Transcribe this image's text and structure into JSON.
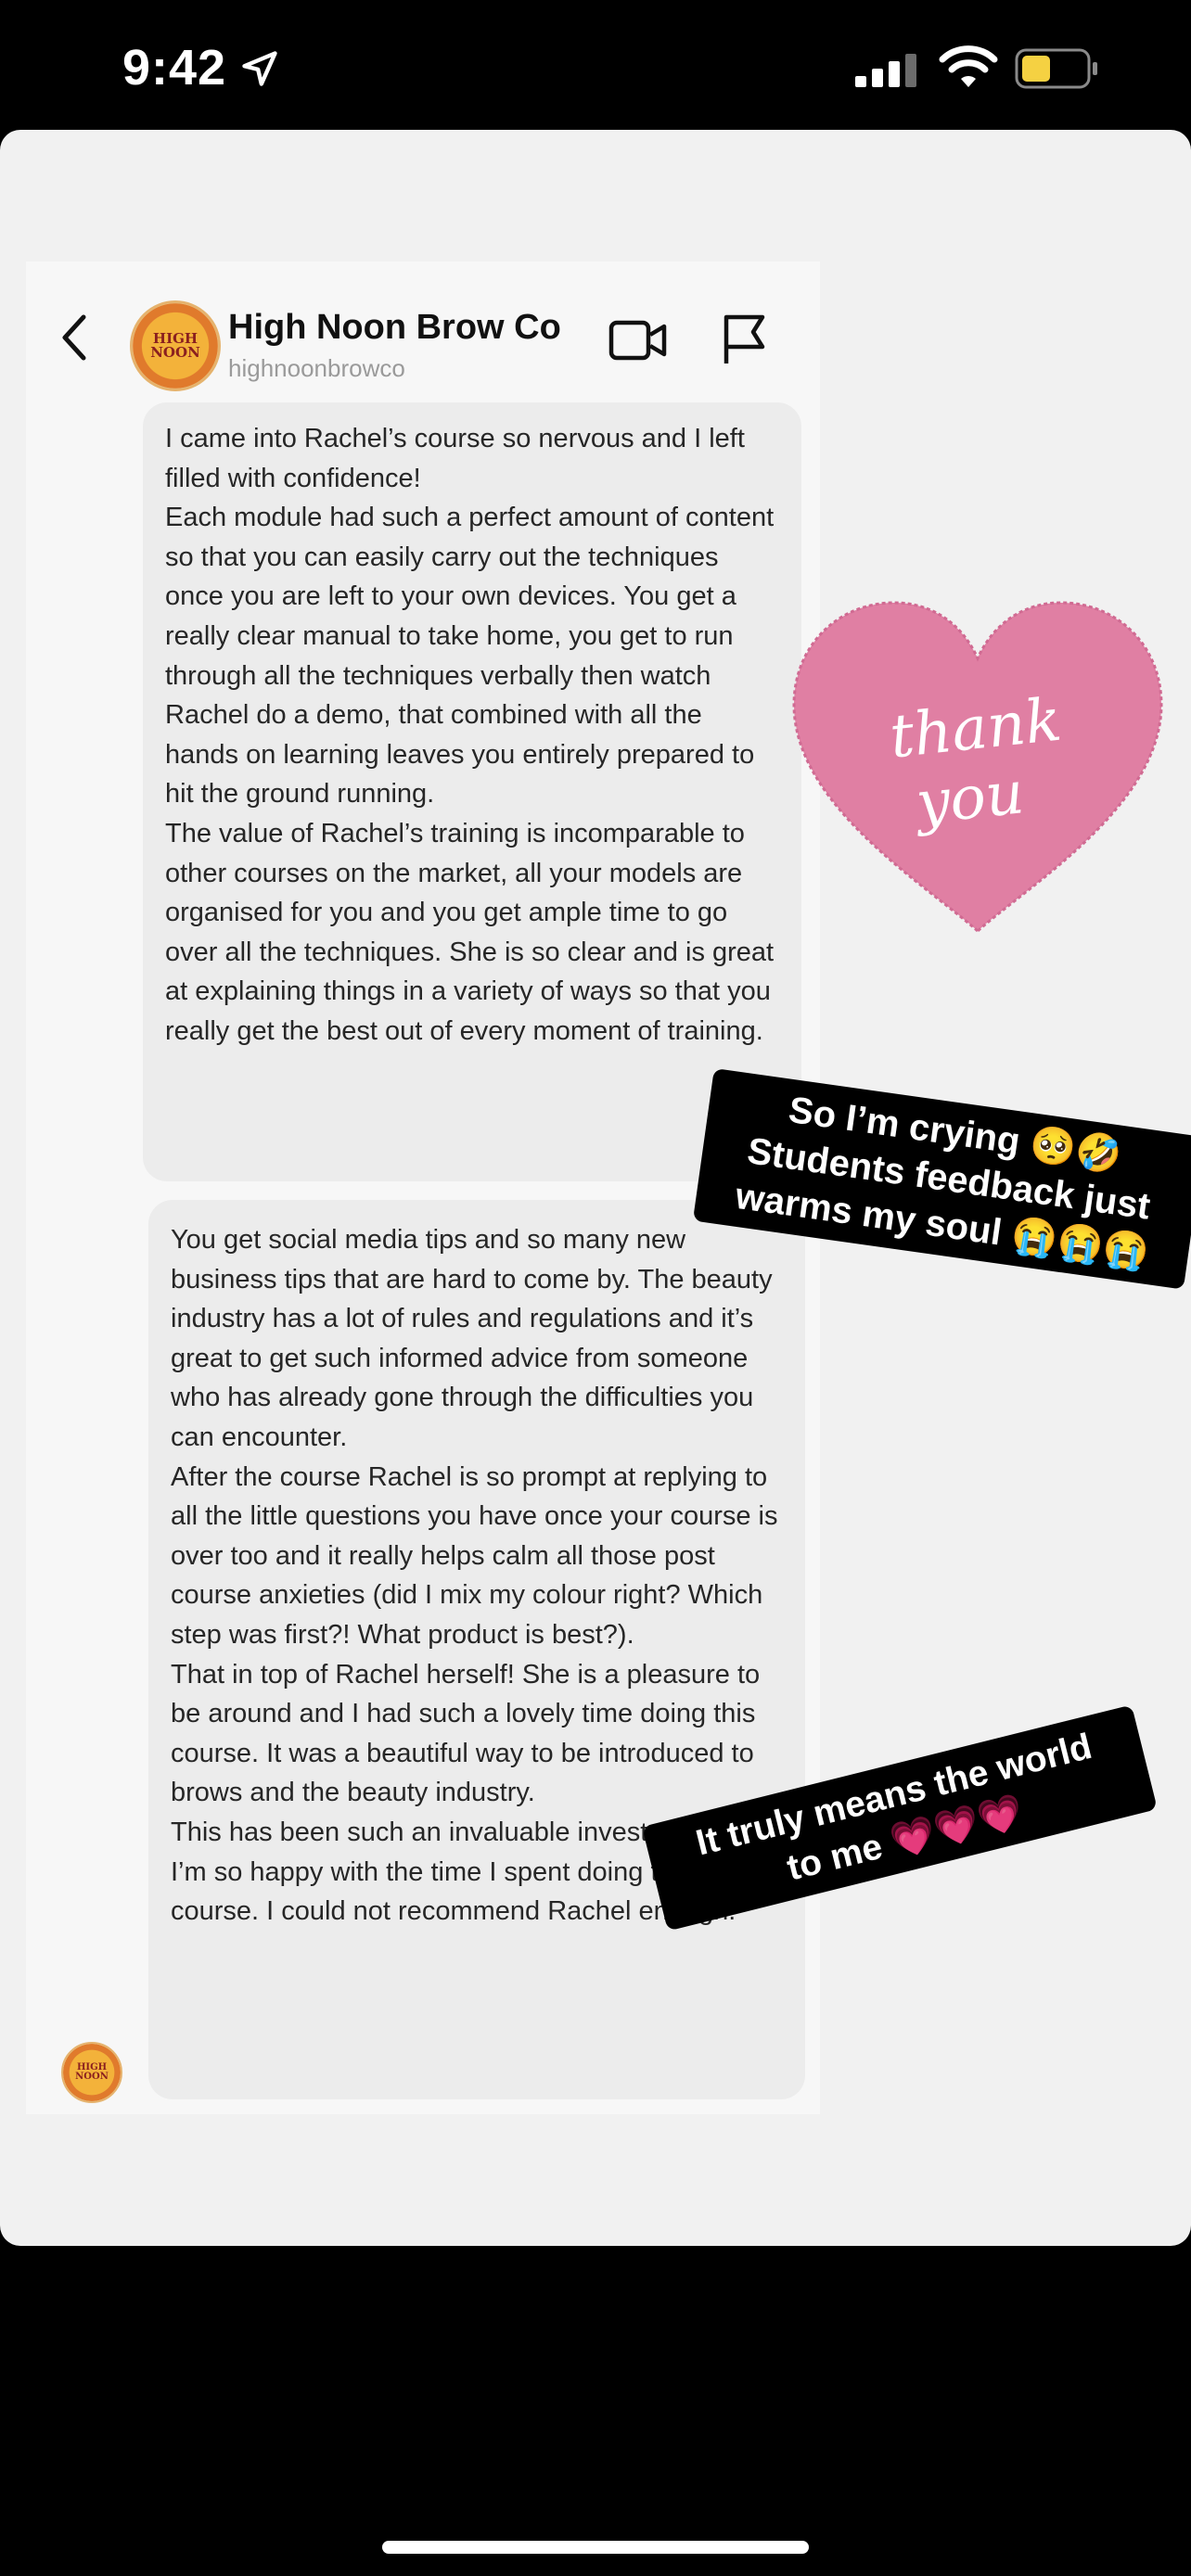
{
  "status_bar": {
    "time": "9:42",
    "icons": [
      "location-arrow-icon",
      "signal-icon",
      "wifi-icon",
      "battery-icon"
    ],
    "battery_color": "#f5d142"
  },
  "chat_header": {
    "name": "High Noon Brow Co",
    "handle": "highnoonbrowco",
    "avatar_text": [
      "HIGH",
      "NOON"
    ],
    "icons": [
      "back-icon",
      "video-call-icon",
      "flag-icon"
    ]
  },
  "messages": [
    {
      "paragraphs": [
        "I came into Rachel’s course so nervous and I left filled with confidence!",
        "Each module had such a perfect amount of content so that you can easily carry out the techniques once you are left to your own devices. You get a really clear manual to take home, you get to run through all the techniques verbally then watch Rachel do a demo, that combined with all the hands on learning leaves you entirely prepared to hit the ground running.",
        "The value of Rachel’s training is incomparable to other courses on the market, all your models are organised for you and you get ample time to go over all the techniques. She is so clear and is great at explaining things in a variety of ways so that you really get the best out of every moment of training."
      ]
    },
    {
      "paragraphs": [
        "You get social media tips and so many new business tips that are hard to come by. The beauty industry has a lot of rules and regulations and it’s great to get such informed advice from someone who has already gone through the difficulties you can encounter.",
        "After the course Rachel is so prompt at replying to all the little questions you have once your course is over too and it really helps calm all those post course anxieties (did I mix my colour right? Which step was first?! What product is best?).",
        "That in top of Rachel herself! She is a pleasure to be around and I had such a lovely time doing this course. It was a beautiful way to be introduced to brows and the beauty industry.",
        "This has been such an invaluable investment and I’m so happy with the time I spent doing this course. I could not recommend Rachel enough!"
      ]
    }
  ],
  "sticker": {
    "text_line1": "thank",
    "text_line2": "you",
    "color": "#e07fa3"
  },
  "captions": {
    "caption1_line1": "So I’m crying 🥺🤣",
    "caption1_line2": "Students feedback just",
    "caption1_line3": "warms my soul 😭😭😭",
    "caption2_line1": "It truly means the world",
    "caption2_line2": "to me 💗💗💗"
  }
}
